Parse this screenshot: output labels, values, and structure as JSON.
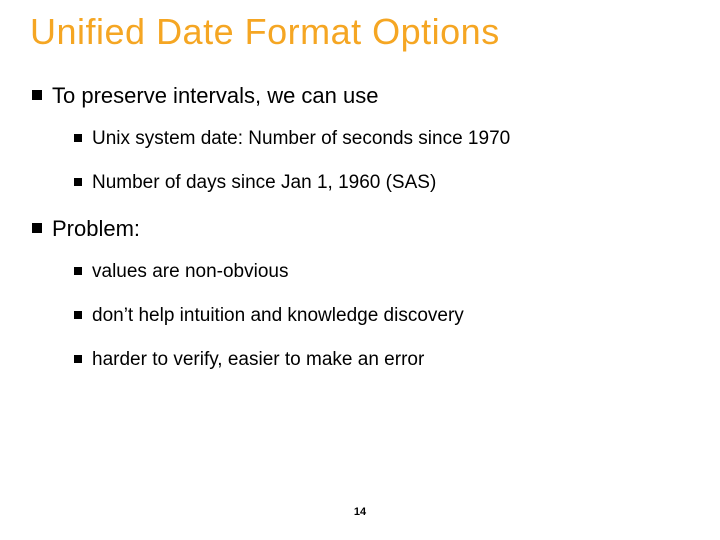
{
  "title": "Unified Date Format Options",
  "bullets": {
    "b1": "To preserve intervals, we can use",
    "b1_1": "Unix system date: Number of seconds since 1970",
    "b1_2": "Number of days since Jan 1, 1960 (SAS)",
    "b2": "Problem:",
    "b2_1": "values are non-obvious",
    "b2_2": "don’t help intuition and knowledge discovery",
    "b2_3": "harder to verify, easier to make an error"
  },
  "page_number": "14"
}
